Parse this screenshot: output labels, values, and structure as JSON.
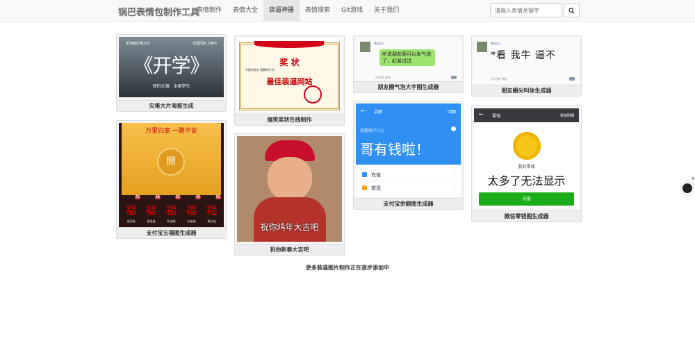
{
  "brand": "锅巴表情包制作工具",
  "nav": [
    "表情制作",
    "表情大全",
    "装逼神器",
    "表情搜索",
    "Git游戏",
    "关于我们"
  ],
  "search": {
    "placeholder": "请输入表情关键字"
  },
  "cards": {
    "c1": {
      "caption": "灾难大片海报生成",
      "tag_left": "史诗级灾难大片",
      "tag_right": "全国同步上映中",
      "title": "《开学》",
      "subtitle": "领衔主演：全国学生"
    },
    "c2": {
      "caption": "搞笑奖状在线制作",
      "header": "奖 状",
      "line": "中国内地名 国蠢网评为:",
      "award": "最佳装逼网站"
    },
    "c3": {
      "caption": "朋友圈气泡大字图生成器",
      "name": "装机达人",
      "bubble": "听说朋友圈可以发气泡了，赶紧试试",
      "meta": "1分钟前  删除"
    },
    "c4": {
      "caption": "朋友圈尖叫体生成器",
      "name": "装机达人",
      "text": "*看 我牛 逼不",
      "meta": "1分钟前  删除"
    },
    "c5": {
      "caption": "支付宝余额图生成器",
      "header_left": "余额",
      "header_right": "明细",
      "label": "余额账户(元)",
      "amount": "哥有钱啦！",
      "item1": "充值",
      "item2": "提现"
    },
    "c6": {
      "caption": "微信零钱图生成器",
      "header_left": "零钱",
      "header_right": "零钱明细",
      "label": "我的零钱",
      "amount": "太多了无法显示",
      "button": "充值"
    },
    "c7": {
      "caption": "支付宝五福图生成器",
      "banner": "万里归家 一路平安",
      "center": "開",
      "fu": [
        "福",
        "福",
        "福",
        "福",
        "福"
      ],
      "counts": [
        "73",
        "46",
        "55",
        "45",
        "55"
      ],
      "labels": [
        "爱国福",
        "富强福",
        "和谐福",
        "友善福",
        "敬业福"
      ]
    },
    "c8": {
      "caption": "祝你新春大吉吧",
      "text": "祝你鸡年大吉吧"
    }
  },
  "footer_note": "更多装逼图片制作正在逐步添加中",
  "float": {
    "close": "x"
  },
  "colors": {
    "alipay_blue": "#2f8ff3",
    "wechat_green": "#1aad19",
    "award_red": "#c8000a"
  }
}
